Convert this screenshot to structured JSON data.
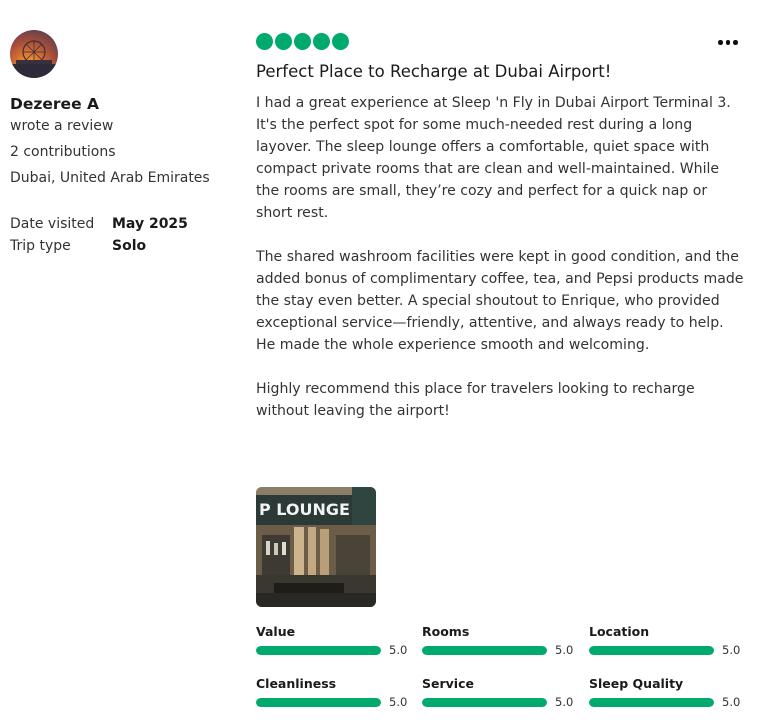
{
  "user": {
    "name": "Dezeree A",
    "action": "wrote a review",
    "contributions": "2 contributions",
    "location": "Dubai, United Arab Emirates"
  },
  "trip_info": [
    {
      "label": "Date visited",
      "value": "May 2025"
    },
    {
      "label": "Trip type",
      "value": "Solo"
    }
  ],
  "review": {
    "rating_bubbles": 5,
    "bubble_color": "#00aa6c",
    "title": "Perfect Place to Recharge at Dubai Airport!",
    "paragraphs": [
      "I had a great experience at Sleep 'n Fly in Dubai Airport Terminal 3. It's the perfect spot for some much-needed rest during a long layover. The sleep lounge offers a comfortable, quiet space with compact private rooms that are clean and well-maintained. While the rooms are small, they’re cozy and perfect for a quick nap or short rest.",
      "The shared washroom facilities were kept in good condition, and the added bonus of complimentary coffee, tea, and Pepsi products made the stay even better. A special shoutout to Enrique, who provided exceptional service—friendly, attentive, and always ready to help. He made the whole experience smooth and welcoming.",
      "Highly recommend this place for travelers looking to recharge without leaving the airport!"
    ],
    "photo_sign_text": "P LOUNGE",
    "more_icon": "more-options-icon"
  },
  "ratings": [
    {
      "label": "Value",
      "score": "5.0",
      "fraction": 1.0
    },
    {
      "label": "Rooms",
      "score": "5.0",
      "fraction": 1.0
    },
    {
      "label": "Location",
      "score": "5.0",
      "fraction": 1.0
    },
    {
      "label": "Cleanliness",
      "score": "5.0",
      "fraction": 1.0
    },
    {
      "label": "Service",
      "score": "5.0",
      "fraction": 1.0
    },
    {
      "label": "Sleep Quality",
      "score": "5.0",
      "fraction": 1.0
    }
  ],
  "colors": {
    "accent": "#00aa6c",
    "track": "#e0e0e0"
  }
}
